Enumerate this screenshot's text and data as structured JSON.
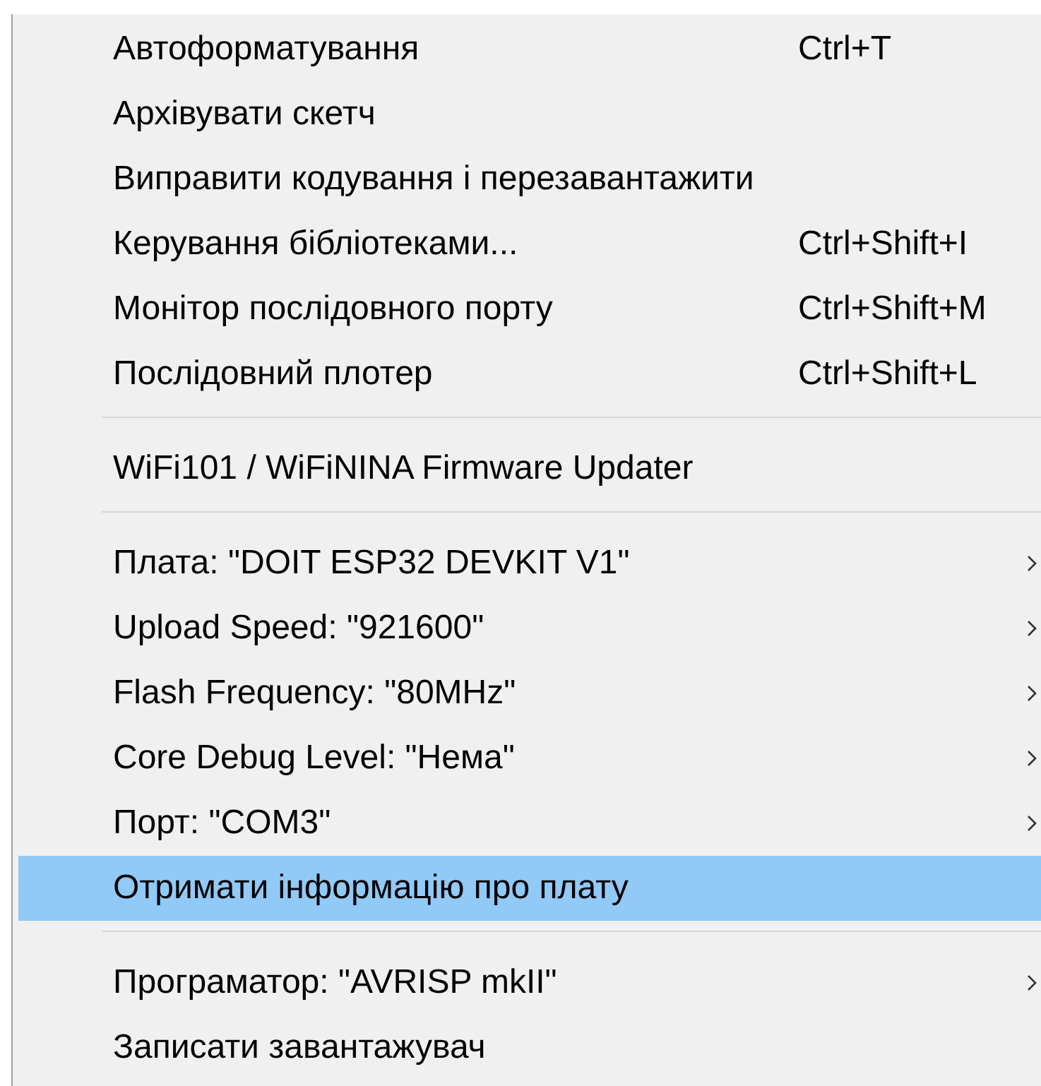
{
  "menu": {
    "items": [
      {
        "kind": "item",
        "label": "Автоформатування",
        "shortcut": "Ctrl+T",
        "submenu": false,
        "selected": false
      },
      {
        "kind": "item",
        "label": "Архівувати скетч",
        "submenu": false,
        "selected": false
      },
      {
        "kind": "item",
        "label": "Виправити кодування і перезавантажити",
        "submenu": false,
        "selected": false
      },
      {
        "kind": "item",
        "label": "Керування бібліотеками...",
        "shortcut": "Ctrl+Shift+I",
        "submenu": false,
        "selected": false
      },
      {
        "kind": "item",
        "label": "Монітор послідовного порту",
        "shortcut": "Ctrl+Shift+M",
        "submenu": false,
        "selected": false
      },
      {
        "kind": "item",
        "label": "Послідовний плотер",
        "shortcut": "Ctrl+Shift+L",
        "submenu": false,
        "selected": false
      },
      {
        "kind": "separator"
      },
      {
        "kind": "item",
        "label": "WiFi101 / WiFiNINA Firmware Updater",
        "submenu": false,
        "selected": false
      },
      {
        "kind": "separator"
      },
      {
        "kind": "item",
        "label": "Плата: \"DOIT ESP32 DEVKIT V1\"",
        "submenu": true,
        "selected": false
      },
      {
        "kind": "item",
        "label": "Upload Speed: \"921600\"",
        "submenu": true,
        "selected": false
      },
      {
        "kind": "item",
        "label": "Flash Frequency: \"80MHz\"",
        "submenu": true,
        "selected": false
      },
      {
        "kind": "item",
        "label": "Core Debug Level: \"Нема\"",
        "submenu": true,
        "selected": false
      },
      {
        "kind": "item",
        "label": "Порт: \"COM3\"",
        "submenu": true,
        "selected": false
      },
      {
        "kind": "item",
        "label": "Отримати інформацію про плату",
        "submenu": false,
        "selected": true
      },
      {
        "kind": "separator"
      },
      {
        "kind": "item",
        "label": "Програматор: \"AVRISP mkII\"",
        "submenu": true,
        "selected": false
      },
      {
        "kind": "item",
        "label": "Записати завантажувач",
        "submenu": false,
        "selected": false
      }
    ]
  }
}
